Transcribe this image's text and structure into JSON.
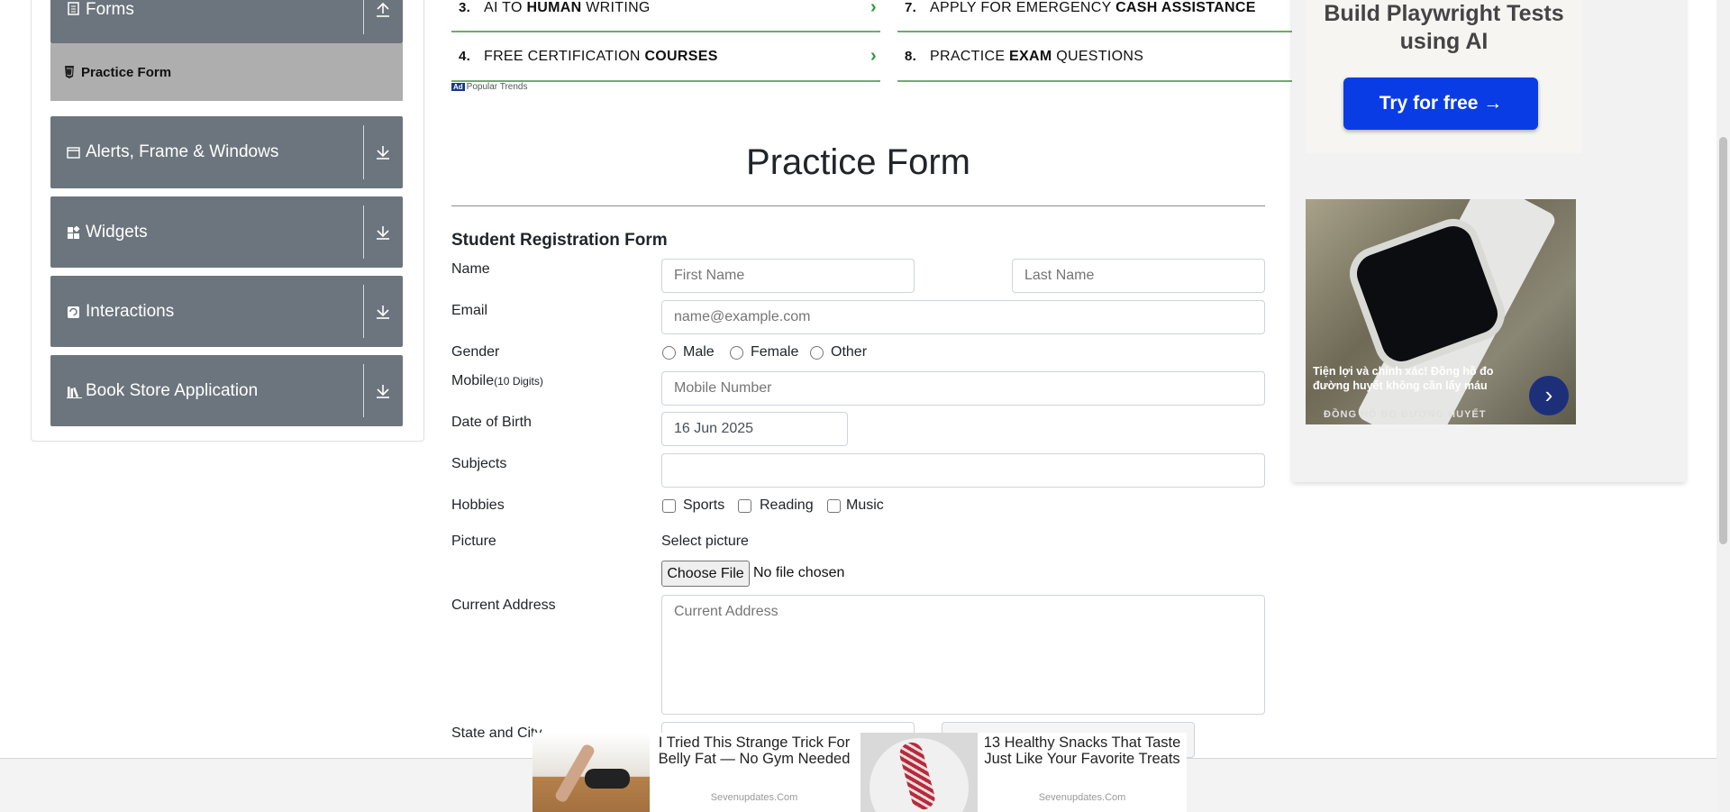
{
  "sidebar": {
    "groups": [
      {
        "label": "Forms",
        "icon": "document-icon",
        "expanded": true
      },
      {
        "label": "Alerts, Frame & Windows",
        "icon": "window-icon",
        "expanded": false
      },
      {
        "label": "Widgets",
        "icon": "widgets-icon",
        "expanded": false
      },
      {
        "label": "Interactions",
        "icon": "interactions-icon",
        "expanded": false
      },
      {
        "label": "Book Store Application",
        "icon": "books-icon",
        "expanded": false
      }
    ],
    "active_item": "Practice Form"
  },
  "ad_links": [
    {
      "num": "3.",
      "text_plain": "AI TO ",
      "text_bold": "HUMAN",
      "text_after": " WRITING"
    },
    {
      "num": "7.",
      "text_plain": "APPLY FOR EMERGENCY ",
      "text_bold": "CASH ASSISTANCE",
      "text_after": ""
    },
    {
      "num": "4.",
      "text_plain": "FREE CERTIFICATION ",
      "text_bold": "COURSES",
      "text_after": ""
    },
    {
      "num": "8.",
      "text_plain": "PRACTICE ",
      "text_bold": "EXAM",
      "text_after": " QUESTIONS"
    }
  ],
  "ad_badge": {
    "tag": "Ad",
    "label": "Popular Trends"
  },
  "page": {
    "title": "Practice Form",
    "form_heading": "Student Registration Form"
  },
  "form": {
    "name_label": "Name",
    "first_name_placeholder": "First Name",
    "last_name_placeholder": "Last Name",
    "email_label": "Email",
    "email_placeholder": "name@example.com",
    "gender_label": "Gender",
    "gender_options": [
      "Male",
      "Female",
      "Other"
    ],
    "mobile_label": "Mobile",
    "mobile_hint": "(10 Digits)",
    "mobile_placeholder": "Mobile Number",
    "dob_label": "Date of Birth",
    "dob_value": "16 Jun 2025",
    "subjects_label": "Subjects",
    "hobbies_label": "Hobbies",
    "hobby_options": [
      "Sports",
      "Reading",
      "Music"
    ],
    "picture_label": "Picture",
    "select_picture": "Select picture",
    "choose_file": "Choose File",
    "file_status": "No file chosen",
    "address_label": "Current Address",
    "address_placeholder": "Current Address",
    "state_city_label": "State and City"
  },
  "right_ad": {
    "headline": "Build Playwright Tests using AI",
    "cta": "Try for free →",
    "photo_caption": "Tiện lợi và chính xác! Đồng hồ đo đường huyết không cần lấy máu",
    "photo_source": "ĐỒNG HỒ ĐO ĐƯỜNG HUYẾT",
    "next_arrow": "›"
  },
  "bottom_ad": {
    "items": [
      {
        "text": "I Tried This Strange Trick For Belly Fat — No Gym Needed",
        "source": "Sevenupdates.Com"
      },
      {
        "text": "13 Healthy Snacks That Taste Just Like Your Favorite Treats",
        "source": "Sevenupdates.Com"
      }
    ]
  },
  "colors": {
    "sidebar_header": "#6c757d",
    "active_item_bg": "#aeaeae",
    "cta_blue": "#0a3ce6",
    "ad_link_green": "#2c9a3a"
  }
}
